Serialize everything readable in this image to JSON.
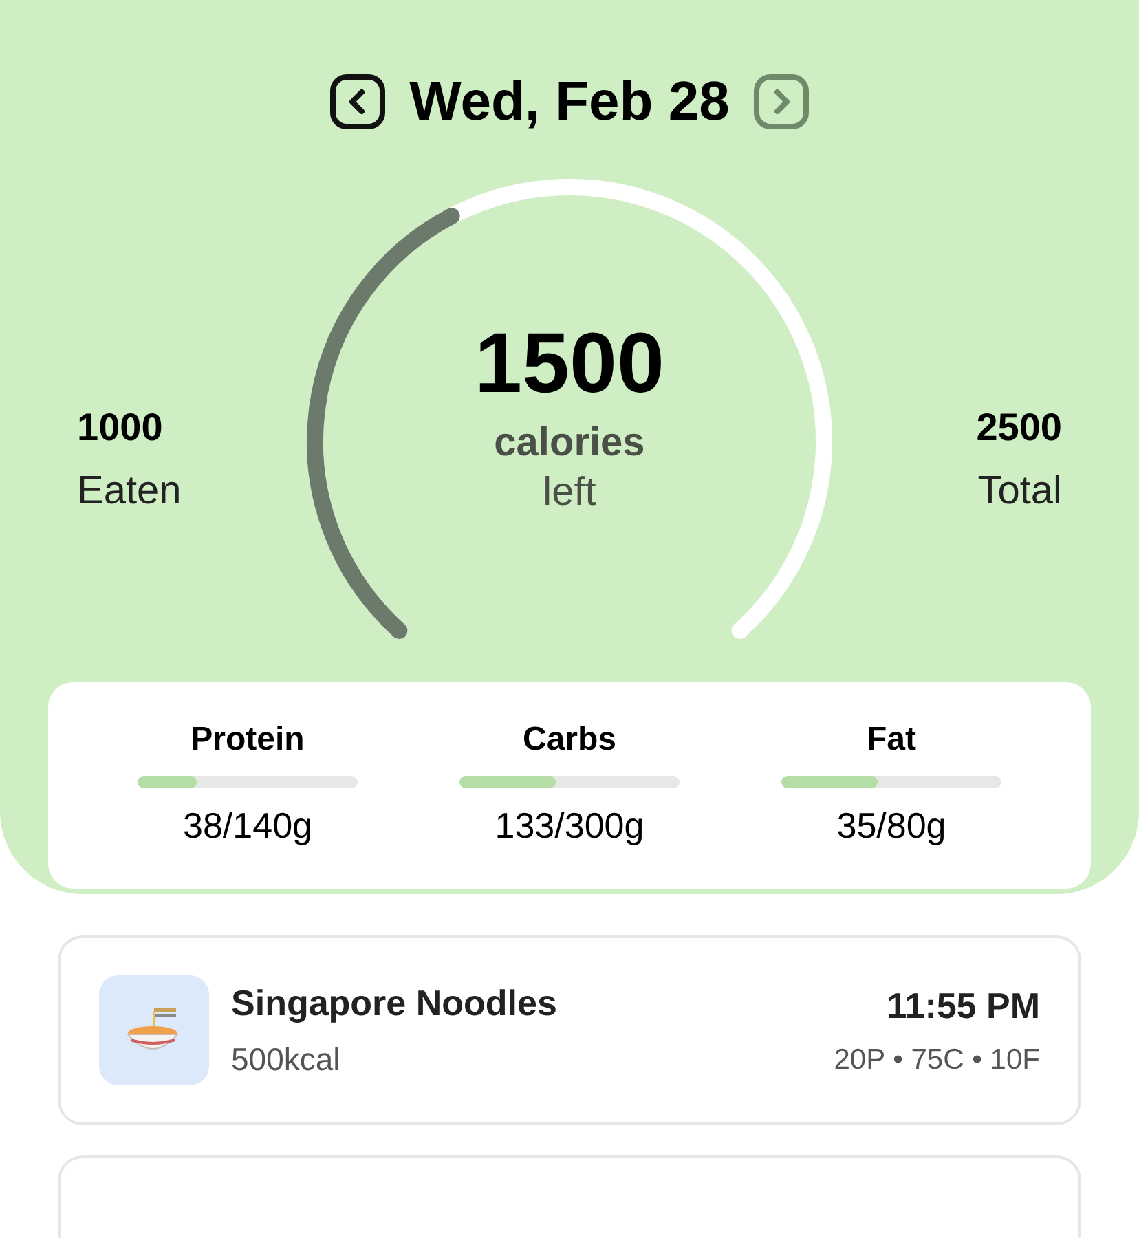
{
  "header": {
    "date": "Wed, Feb 28",
    "prev_enabled": true,
    "next_enabled": false
  },
  "gauge": {
    "value": "1500",
    "unit": "calories",
    "caption": "left"
  },
  "eaten": {
    "value": "1000",
    "label": "Eaten"
  },
  "total": {
    "value": "2500",
    "label": "Total"
  },
  "macros": [
    {
      "name": "Protein",
      "level": 0.27,
      "amount": "38/140g"
    },
    {
      "name": "Carbs",
      "level": 0.44,
      "amount": "133/300g"
    },
    {
      "name": "Fat",
      "level": 0.44,
      "amount": "35/80g"
    }
  ],
  "meals": [
    {
      "name": "Singapore Noodles",
      "calories": "500kcal",
      "time": "11:55 PM",
      "macros": "20P • 75C • 10F"
    }
  ]
}
